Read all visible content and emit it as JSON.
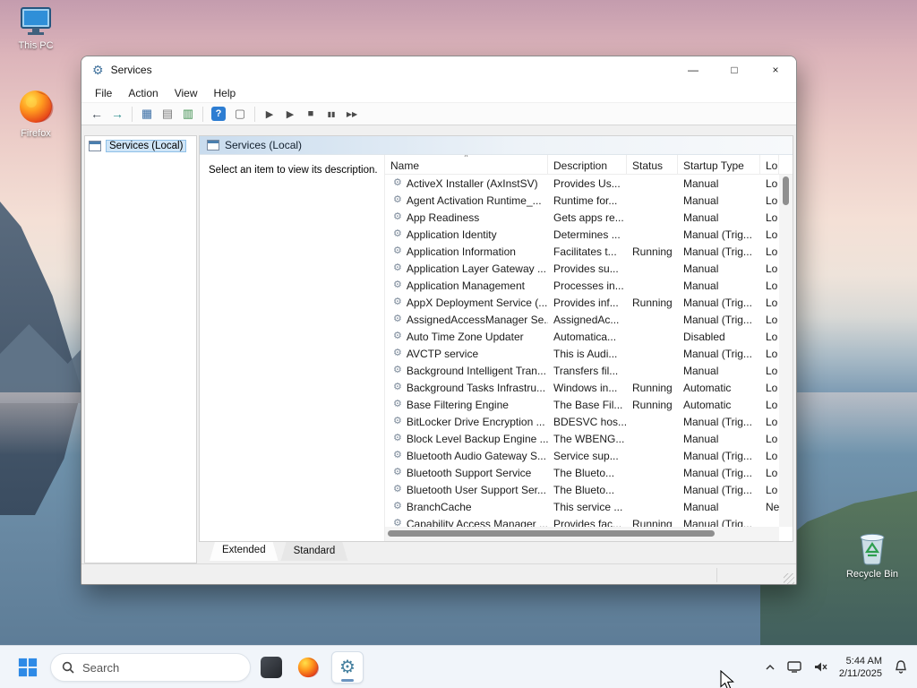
{
  "desktop": {
    "icons": {
      "this_pc": "This PC",
      "firefox": "Firefox",
      "recycle_bin": "Recycle Bin"
    }
  },
  "window": {
    "title": "Services",
    "controls": {
      "minimize": "—",
      "maximize": "□",
      "close": "×"
    },
    "menu": [
      "File",
      "Action",
      "View",
      "Help"
    ],
    "toolbar": [
      {
        "name": "back-icon",
        "glyph": "←",
        "color": "#3f4a55",
        "size": 14
      },
      {
        "name": "forward-icon",
        "glyph": "→",
        "color": "#2e8f8f",
        "size": 14
      },
      {
        "sep": true
      },
      {
        "name": "console-tree-icon",
        "glyph": "▦",
        "color": "#3a6ea5",
        "size": 13
      },
      {
        "name": "properties-icon",
        "glyph": "▤",
        "color": "#7a7a7a",
        "size": 13
      },
      {
        "name": "export-list-icon",
        "glyph": "▥",
        "color": "#3f8f4f",
        "size": 13
      },
      {
        "sep": true
      },
      {
        "name": "help-icon",
        "glyph": "?",
        "boxed": true
      },
      {
        "name": "snapin-window-icon",
        "glyph": "▢",
        "color": "#6a6a6a",
        "size": 13
      },
      {
        "sep": true
      },
      {
        "name": "start-service-icon",
        "glyph": "▶",
        "color": "#4a4a4a",
        "size": 11
      },
      {
        "name": "resume-service-icon",
        "glyph": "▶",
        "color": "#4a4a4a",
        "size": 11
      },
      {
        "name": "stop-service-icon",
        "glyph": "■",
        "color": "#4a4a4a",
        "size": 11
      },
      {
        "name": "pause-service-icon",
        "glyph": "▮▮",
        "color": "#4a4a4a",
        "size": 8
      },
      {
        "name": "restart-service-icon",
        "glyph": "▶▶",
        "color": "#4a4a4a",
        "size": 8
      }
    ],
    "tree": {
      "root_label": "Services (Local)"
    },
    "panel": {
      "header": "Services (Local)",
      "description_hint": "Select an item to view its description."
    },
    "table": {
      "row_icon_glyph": "⚙",
      "columns": [
        {
          "label": "Name",
          "sorted": true
        },
        {
          "label": "Description"
        },
        {
          "label": "Status"
        },
        {
          "label": "Startup Type"
        },
        {
          "label": "Lo"
        }
      ],
      "rows": [
        {
          "name": "ActiveX Installer (AxInstSV)",
          "description": "Provides Us...",
          "status": "",
          "startup": "Manual",
          "logon": "Lo"
        },
        {
          "name": "Agent Activation Runtime_...",
          "description": "Runtime for...",
          "status": "",
          "startup": "Manual",
          "logon": "Lo"
        },
        {
          "name": "App Readiness",
          "description": "Gets apps re...",
          "status": "",
          "startup": "Manual",
          "logon": "Lo"
        },
        {
          "name": "Application Identity",
          "description": "Determines ...",
          "status": "",
          "startup": "Manual (Trig...",
          "logon": "Lo"
        },
        {
          "name": "Application Information",
          "description": "Facilitates t...",
          "status": "Running",
          "startup": "Manual (Trig...",
          "logon": "Lo"
        },
        {
          "name": "Application Layer Gateway ...",
          "description": "Provides su...",
          "status": "",
          "startup": "Manual",
          "logon": "Lo"
        },
        {
          "name": "Application Management",
          "description": "Processes in...",
          "status": "",
          "startup": "Manual",
          "logon": "Lo"
        },
        {
          "name": "AppX Deployment Service (...",
          "description": "Provides inf...",
          "status": "Running",
          "startup": "Manual (Trig...",
          "logon": "Lo"
        },
        {
          "name": "AssignedAccessManager Se...",
          "description": "AssignedAc...",
          "status": "",
          "startup": "Manual (Trig...",
          "logon": "Lo"
        },
        {
          "name": "Auto Time Zone Updater",
          "description": "Automatica...",
          "status": "",
          "startup": "Disabled",
          "logon": "Lo"
        },
        {
          "name": "AVCTP service",
          "description": "This is Audi...",
          "status": "",
          "startup": "Manual (Trig...",
          "logon": "Lo"
        },
        {
          "name": "Background Intelligent Tran...",
          "description": "Transfers fil...",
          "status": "",
          "startup": "Manual",
          "logon": "Lo"
        },
        {
          "name": "Background Tasks Infrastru...",
          "description": "Windows in...",
          "status": "Running",
          "startup": "Automatic",
          "logon": "Lo"
        },
        {
          "name": "Base Filtering Engine",
          "description": "The Base Fil...",
          "status": "Running",
          "startup": "Automatic",
          "logon": "Lo"
        },
        {
          "name": "BitLocker Drive Encryption ...",
          "description": "BDESVC hos...",
          "status": "",
          "startup": "Manual (Trig...",
          "logon": "Lo"
        },
        {
          "name": "Block Level Backup Engine ...",
          "description": "The WBENG...",
          "status": "",
          "startup": "Manual",
          "logon": "Lo"
        },
        {
          "name": "Bluetooth Audio Gateway S...",
          "description": "Service sup...",
          "status": "",
          "startup": "Manual (Trig...",
          "logon": "Lo"
        },
        {
          "name": "Bluetooth Support Service",
          "description": "The Blueto...",
          "status": "",
          "startup": "Manual (Trig...",
          "logon": "Lo"
        },
        {
          "name": "Bluetooth User Support Ser...",
          "description": "The Blueto...",
          "status": "",
          "startup": "Manual (Trig...",
          "logon": "Lo"
        },
        {
          "name": "BranchCache",
          "description": "This service ...",
          "status": "",
          "startup": "Manual",
          "logon": "Ne"
        },
        {
          "name": "Capability Access Manager ...",
          "description": "Provides fac...",
          "status": "Running",
          "startup": "Manual (Trig...",
          "logon": ""
        }
      ]
    },
    "tabs": [
      {
        "label": "Extended",
        "active": true
      },
      {
        "label": "Standard",
        "active": false
      }
    ]
  },
  "taskbar": {
    "search_placeholder": "Search",
    "clock_time": "5:44 AM",
    "clock_date": "2/11/2025"
  }
}
